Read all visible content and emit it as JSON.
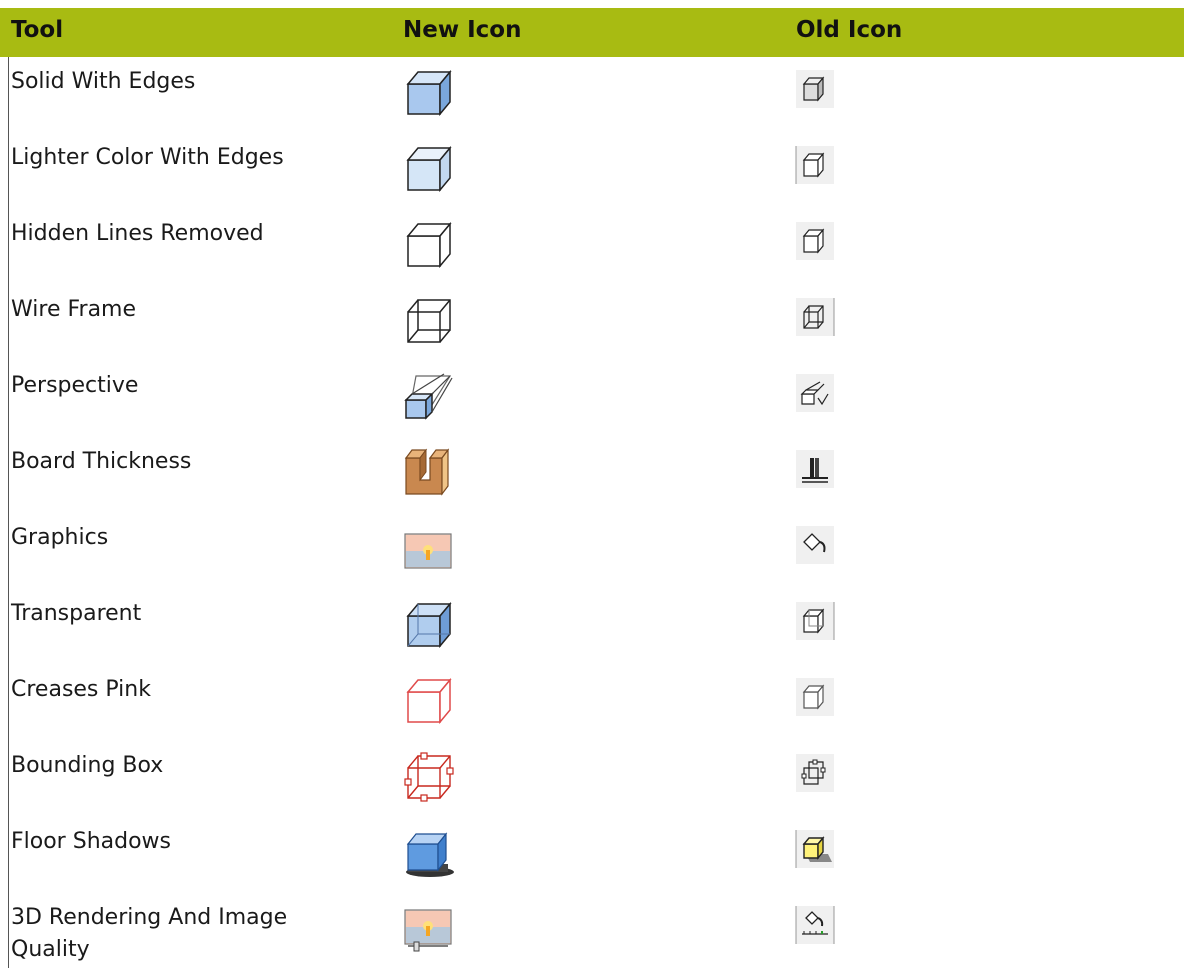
{
  "header": {
    "tool": "Tool",
    "new_icon": "New Icon",
    "old_icon": "Old Icon",
    "color": "#a8bb12"
  },
  "rows": [
    {
      "tool": "Solid With Edges",
      "new_icon": "cube-solid-edges-icon",
      "old_icon": "cube-small-solid-icon"
    },
    {
      "tool": "Lighter Color With Edges",
      "new_icon": "cube-light-edges-icon",
      "old_icon": "cube-small-light-icon"
    },
    {
      "tool": "Hidden Lines Removed",
      "new_icon": "cube-hidden-lines-icon",
      "old_icon": "cube-small-hidden-icon"
    },
    {
      "tool": "Wire Frame",
      "new_icon": "cube-wireframe-icon",
      "old_icon": "cube-small-wireframe-icon"
    },
    {
      "tool": "Perspective",
      "new_icon": "perspective-prism-icon",
      "old_icon": "perspective-small-icon"
    },
    {
      "tool": "Board Thickness",
      "new_icon": "board-thickness-icon",
      "old_icon": "board-thickness-small-icon"
    },
    {
      "tool": "Graphics",
      "new_icon": "sunset-graphics-icon",
      "old_icon": "paint-bucket-icon"
    },
    {
      "tool": "Transparent",
      "new_icon": "cube-transparent-icon",
      "old_icon": "cube-small-transparent-icon"
    },
    {
      "tool": "Creases Pink",
      "new_icon": "cube-pink-creases-icon",
      "old_icon": "cube-small-creases-icon"
    },
    {
      "tool": "Bounding Box",
      "new_icon": "cube-bounding-box-icon",
      "old_icon": "cube-small-bounding-box-icon"
    },
    {
      "tool": "Floor Shadows",
      "new_icon": "cube-floor-shadow-icon",
      "old_icon": "cube-yellow-shadow-icon"
    },
    {
      "tool": "3D Rendering And Image Quality",
      "new_icon": "sunset-slider-icon",
      "old_icon": "paint-bucket-ruler-icon"
    }
  ]
}
